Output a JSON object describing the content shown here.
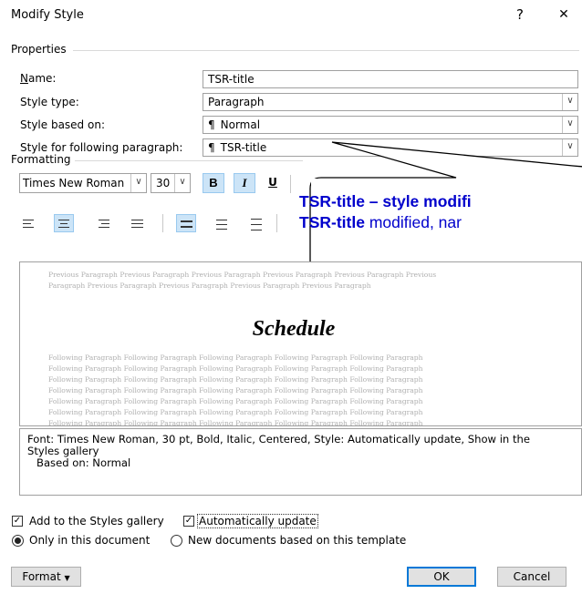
{
  "dialog": {
    "title": "Modify Style",
    "help": "?",
    "close": "✕"
  },
  "properties": {
    "section": "Properties",
    "name_label": "Name:",
    "name_value": "TSR-title",
    "type_label": "Style type:",
    "type_value": "Paragraph",
    "based_label": "Style based on:",
    "based_value": "Normal",
    "following_label": "Style for following paragraph:",
    "following_value": "TSR-title"
  },
  "formatting": {
    "section": "Formatting",
    "font": "Times New Roman",
    "size": "30",
    "bold": "B",
    "italic": "I",
    "underline": "U"
  },
  "callout": {
    "line1_bold": "TSR-title – style modifi",
    "line2_bold": "TSR-title",
    "line2_rest": " modified, nar"
  },
  "preview": {
    "previous_1": "Previous Paragraph Previous Paragraph Previous Paragraph Previous Paragraph Previous Paragraph Previous",
    "previous_2": "Paragraph Previous Paragraph Previous Paragraph Previous Paragraph Previous Paragraph",
    "sample": "Schedule",
    "following": "Following Paragraph Following Paragraph Following Paragraph Following Paragraph Following Paragraph"
  },
  "description": {
    "line1": "Font: Times New Roman, 30 pt, Bold, Italic, Centered, Style: Automatically update, Show in the",
    "line2": "Styles gallery",
    "line3": "Based on: Normal"
  },
  "options": {
    "add_gallery": "Add to the Styles gallery",
    "add_gallery_checked": true,
    "auto_update": "Automatically update",
    "auto_update_checked": true,
    "only_doc": "Only in this document",
    "new_docs": "New documents based on this template"
  },
  "buttons": {
    "format": "Format",
    "ok": "OK",
    "cancel": "Cancel"
  },
  "colors": {
    "callout_text": "#0000cc",
    "toggle_bg": "#cce4f7",
    "default_border": "#0078d7"
  }
}
